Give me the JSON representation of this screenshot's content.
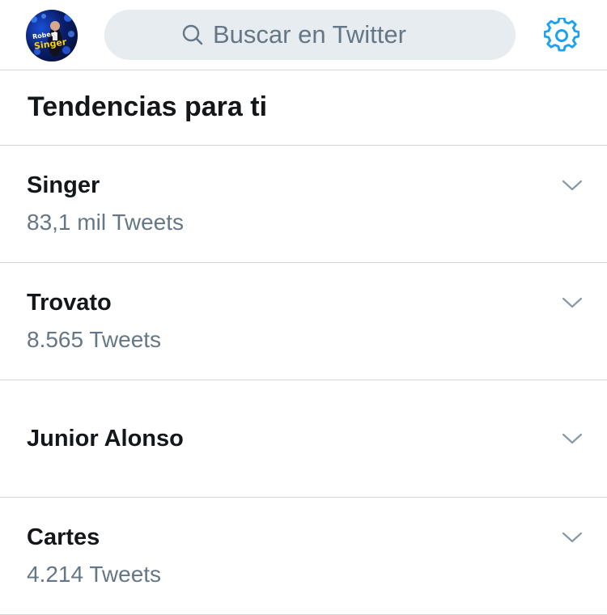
{
  "header": {
    "avatar_text_top": "Robert",
    "avatar_text_bottom": "Singer",
    "search_placeholder": "Buscar en Twitter",
    "search_icon": "search-icon",
    "settings_icon": "gear-icon",
    "accent_color": "#1da1f2",
    "search_bg_color": "#e6ecf0"
  },
  "section": {
    "title": "Tendencias para ti"
  },
  "trends": [
    {
      "name": "Singer",
      "count": "83,1 mil Tweets",
      "icon": "chevron-down-icon"
    },
    {
      "name": "Trovato",
      "count": "8.565 Tweets",
      "icon": "chevron-down-icon"
    },
    {
      "name": "Junior Alonso",
      "count": "",
      "icon": "chevron-down-icon"
    },
    {
      "name": "Cartes",
      "count": "4.214 Tweets",
      "icon": "chevron-down-icon"
    }
  ]
}
